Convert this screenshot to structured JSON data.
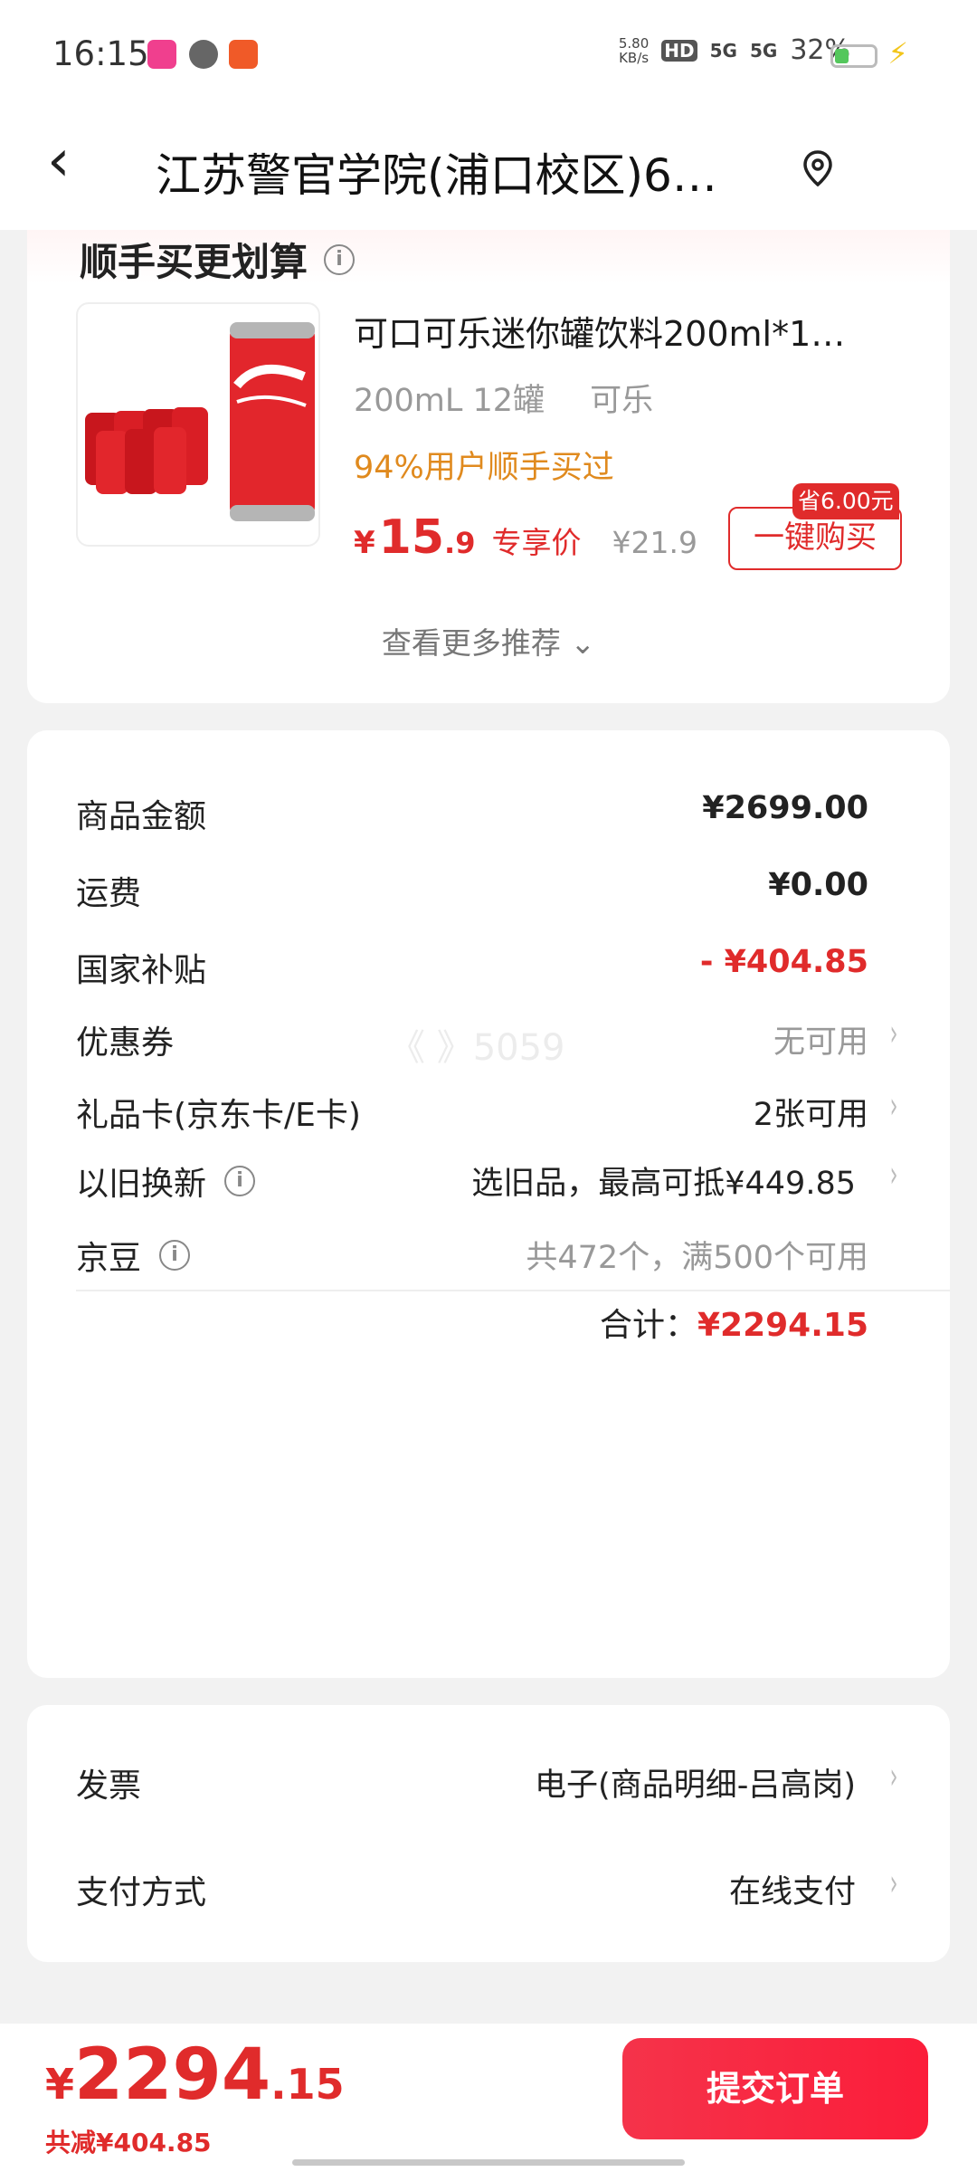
{
  "status_bar": {
    "time": "16:15",
    "net_speed": "5.80\nKB/s",
    "hd": "HD",
    "signal1": "5G",
    "signal2": "5G",
    "battery": "32%"
  },
  "header": {
    "title": "江苏警官学院(浦口校区)6…",
    "icons": [
      "back-arrow-icon",
      "location-pin-icon"
    ]
  },
  "recommend": {
    "title": "顺手买更划算",
    "product": {
      "name": "可口可乐迷你罐饮料200ml*1…",
      "spec": "200mL 12罐",
      "flavor": "可乐",
      "tag": "94%用户顺手买过",
      "price_symbol": "¥",
      "price_int": "15",
      "price_dec": ".9",
      "price_label": "专享价",
      "original_price": "¥21.9",
      "save_tag": "省6.00元",
      "buy_label": "一键购买"
    },
    "more_label": "查看更多推荐 ⌄"
  },
  "summary": {
    "rows": [
      {
        "label": "商品金额",
        "value": "¥2699.00"
      },
      {
        "label": "运费",
        "value": "¥0.00"
      },
      {
        "label": "国家补贴",
        "value": "- ¥404.85"
      },
      {
        "label": "优惠券",
        "value": "无可用"
      },
      {
        "label": "礼品卡(京东卡/E卡)",
        "value": "2张可用"
      },
      {
        "label": "以旧换新",
        "value": "选旧品，最高可抵¥449.85"
      },
      {
        "label": "京豆",
        "value": "共472个，满500个可用"
      }
    ],
    "total_label": "合计：",
    "total_value": "¥2294.15",
    "watermark": "《 》5059"
  },
  "invoice": {
    "rows": [
      {
        "label": "发票",
        "value": "电子(商品明细-吕高岗)"
      },
      {
        "label": "支付方式",
        "value": "在线支付"
      }
    ]
  },
  "bottom_bar": {
    "price_symbol": "¥",
    "price_int": "2294",
    "price_dec": ".15",
    "saving": "共减¥404.85",
    "submit_label": "提交订单"
  },
  "colors": {
    "accent_red": "#e02b2b",
    "tag_orange": "#e08a1e",
    "background": "#f2f2f2"
  }
}
